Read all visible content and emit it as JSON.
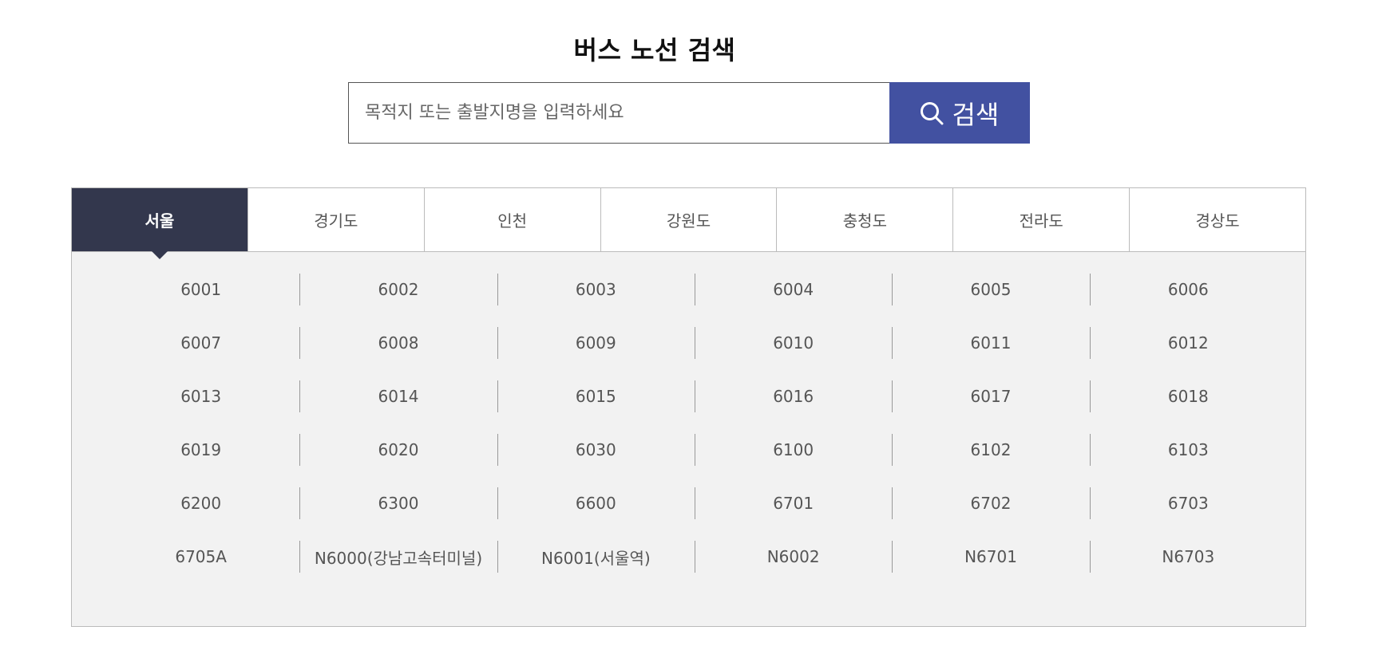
{
  "page": {
    "title": "버스 노선 검색"
  },
  "search": {
    "placeholder": "목적지 또는 출발지명을 입력하세요",
    "value": "",
    "button_label": "검색"
  },
  "tabs": [
    {
      "label": "서울",
      "active": true
    },
    {
      "label": "경기도",
      "active": false
    },
    {
      "label": "인천",
      "active": false
    },
    {
      "label": "강원도",
      "active": false
    },
    {
      "label": "충청도",
      "active": false
    },
    {
      "label": "전라도",
      "active": false
    },
    {
      "label": "경상도",
      "active": false
    }
  ],
  "routes": [
    "6001",
    "6002",
    "6003",
    "6004",
    "6005",
    "6006",
    "6007",
    "6008",
    "6009",
    "6010",
    "6011",
    "6012",
    "6013",
    "6014",
    "6015",
    "6016",
    "6017",
    "6018",
    "6019",
    "6020",
    "6030",
    "6100",
    "6102",
    "6103",
    "6200",
    "6300",
    "6600",
    "6701",
    "6702",
    "6703",
    "6705A",
    "N6000(강남고속터미널)",
    "N6001(서울역)",
    "N6002",
    "N6701",
    "N6703"
  ],
  "colors": {
    "accent": "#4251a1",
    "active_tab": "#33374d",
    "panel_bg": "#f2f2f2"
  },
  "icons": {
    "search_button": "search-icon"
  }
}
